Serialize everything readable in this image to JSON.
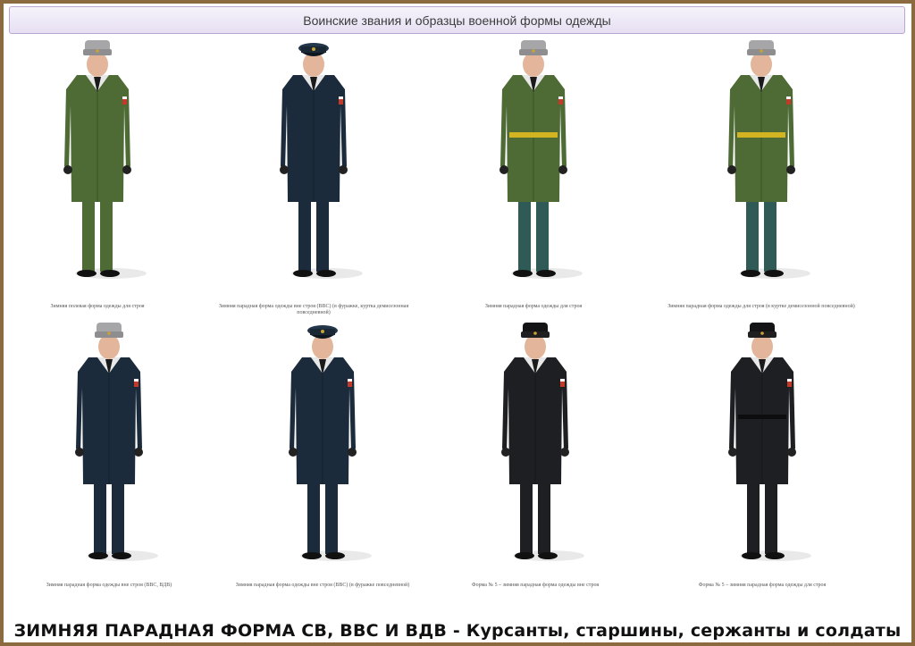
{
  "header": {
    "title": "Воинские звания и образцы военной формы одежды"
  },
  "figures": [
    {
      "caption": "Зимняя полевая форма одежды для строя",
      "coat": "#4e6b35",
      "trousers": "#4e6b35",
      "hat": "ushanka-gray",
      "belt": "none"
    },
    {
      "caption": "Зимняя парадная форма одежды вне строя (ВВС) (в фуражке, куртка демисезонная повседневной)",
      "coat": "#1b2b3c",
      "trousers": "#1b2b3c",
      "hat": "cap-blue",
      "belt": "none"
    },
    {
      "caption": "Зимняя парадная форма одежды для строя",
      "coat": "#4e6b35",
      "trousers": "#2f5a56",
      "hat": "ushanka-gray",
      "belt": "gold"
    },
    {
      "caption": "Зимняя парадная форма одежды для строя (в куртке демисезонной повседневной)",
      "coat": "#4e6b35",
      "trousers": "#2f5a56",
      "hat": "ushanka-gray",
      "belt": "gold"
    },
    {
      "caption": "Зимняя парадная форма одежды вне строя (ВВС, ВДВ)",
      "coat": "#1b2b3c",
      "trousers": "#1b2b3c",
      "hat": "ushanka-gray",
      "belt": "none"
    },
    {
      "caption": "Зимняя парадная форма одежды вне строя (ВВС) (в фуражке повседневной)",
      "coat": "#1b2b3c",
      "trousers": "#1b2b3c",
      "hat": "cap-blue",
      "belt": "none"
    },
    {
      "caption": "Форма № 5 – зимняя парадная форма одежды вне строя",
      "coat": "#1e1f23",
      "trousers": "#1e1f23",
      "hat": "ushanka-black",
      "belt": "none"
    },
    {
      "caption": "Форма № 5 – зимняя парадная форма одежды для строя",
      "coat": "#1e1f23",
      "trousers": "#1e1f23",
      "hat": "ushanka-black",
      "belt": "black"
    }
  ],
  "footer": {
    "text": "ЗИМНЯЯ  ПАРАДНАЯ ФОРМА СВ, ВВС  И ВДВ - Курсанты, старшины, сержанты и солдаты"
  }
}
